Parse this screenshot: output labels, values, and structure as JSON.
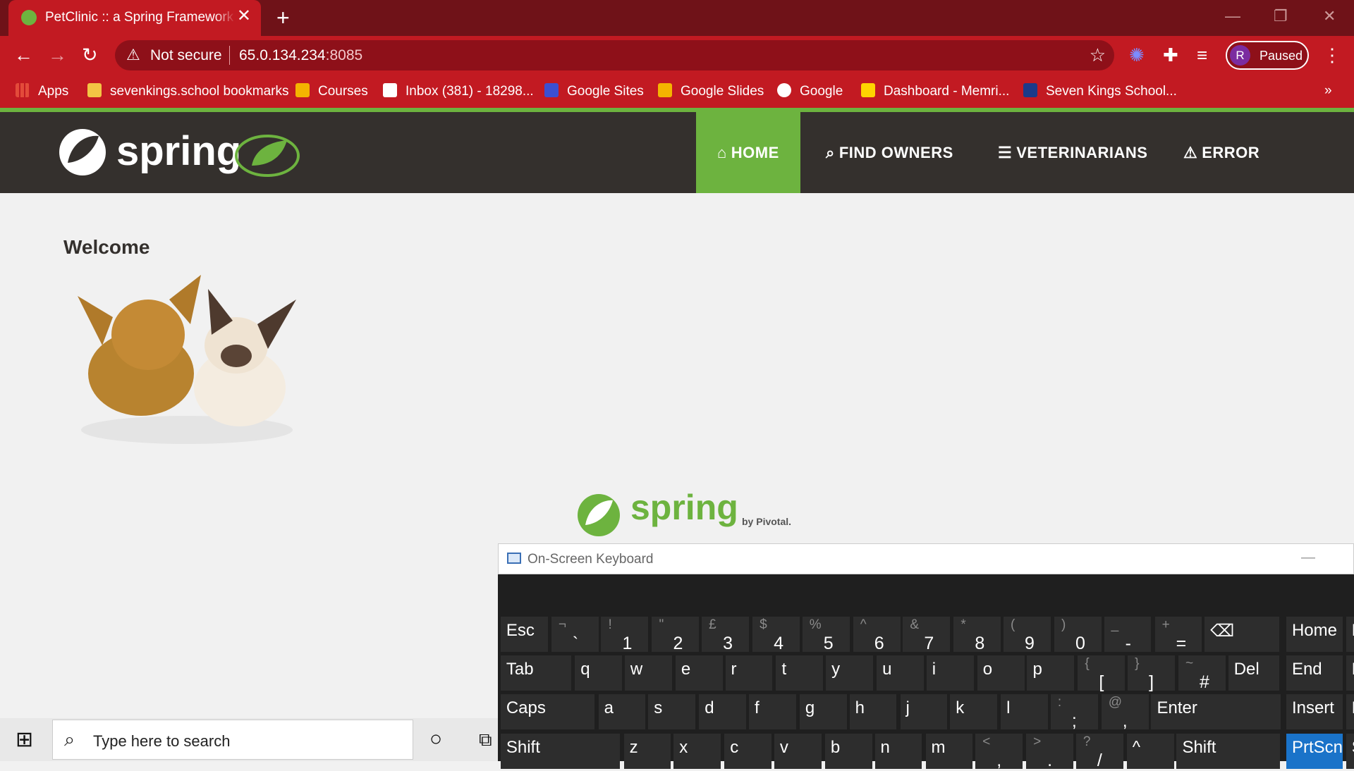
{
  "browser": {
    "tab_title": "PetClinic :: a Spring Framework demonstration",
    "tab_close": "✕",
    "new_tab": "+",
    "security_label": "Not secure",
    "url_host": "65.0.134.234",
    "url_port": ":8085",
    "profile_initial": "R",
    "profile_status": "Paused",
    "bookmarks": [
      {
        "label": "Apps",
        "icon": "apps-icon",
        "color": "#e34b3a"
      },
      {
        "label": "sevenkings.school bookmarks",
        "icon": "folder-icon",
        "color": "#f3c544"
      },
      {
        "label": "Courses",
        "icon": "classroom-icon",
        "color": "#f4b400"
      },
      {
        "label": "Inbox (381) - 18298...",
        "icon": "gmail-icon",
        "color": "#ffffff"
      },
      {
        "label": "Google Sites",
        "icon": "sites-icon",
        "color": "#3b4fd1"
      },
      {
        "label": "Google Slides",
        "icon": "slides-icon",
        "color": "#f4b400"
      },
      {
        "label": "Google",
        "icon": "google-icon",
        "color": "#ffffff"
      },
      {
        "label": "Dashboard - Memri...",
        "icon": "memrise-icon",
        "color": "#ffd400"
      },
      {
        "label": "Seven Kings School...",
        "icon": "school-icon",
        "color": "#1b3a8a"
      }
    ],
    "more_bookmarks": "»"
  },
  "site": {
    "nav": [
      {
        "label": "HOME",
        "icon": "home-icon",
        "active": true
      },
      {
        "label": "FIND OWNERS",
        "icon": "search-icon",
        "active": false
      },
      {
        "label": "VETERINARIANS",
        "icon": "list-icon",
        "active": false
      },
      {
        "label": "ERROR",
        "icon": "warning-icon",
        "active": false
      }
    ],
    "heading": "Welcome",
    "logo_text": "spring",
    "footer_logo_text": "spring",
    "footer_by": "by Pivotal."
  },
  "osk": {
    "title": "On-Screen Keyboard",
    "minimize": "—",
    "rows": [
      [
        [
          "Esc",
          ""
        ],
        [
          "`",
          "¬"
        ],
        [
          "1",
          "!"
        ],
        [
          "2",
          "\""
        ],
        [
          "3",
          "£"
        ],
        [
          "4",
          "$"
        ],
        [
          "5",
          "%"
        ],
        [
          "6",
          "^"
        ],
        [
          "7",
          "&"
        ],
        [
          "8",
          "*"
        ],
        [
          "9",
          "("
        ],
        [
          "0",
          ")"
        ],
        [
          "-",
          "_"
        ],
        [
          "=",
          "+"
        ],
        [
          "⌫",
          ""
        ],
        [
          "Home",
          ""
        ],
        [
          "PgUp",
          ""
        ]
      ],
      [
        [
          "Tab",
          ""
        ],
        [
          "q",
          ""
        ],
        [
          "w",
          ""
        ],
        [
          "e",
          ""
        ],
        [
          "r",
          ""
        ],
        [
          "t",
          ""
        ],
        [
          "y",
          ""
        ],
        [
          "u",
          ""
        ],
        [
          "i",
          ""
        ],
        [
          "o",
          ""
        ],
        [
          "p",
          ""
        ],
        [
          "[",
          "{"
        ],
        [
          "]",
          "}"
        ],
        [
          "#",
          "~"
        ],
        [
          "Del",
          ""
        ],
        [
          "End",
          ""
        ],
        [
          "PgDn",
          ""
        ]
      ],
      [
        [
          "Caps",
          ""
        ],
        [
          "a",
          ""
        ],
        [
          "s",
          ""
        ],
        [
          "d",
          ""
        ],
        [
          "f",
          ""
        ],
        [
          "g",
          ""
        ],
        [
          "h",
          ""
        ],
        [
          "j",
          ""
        ],
        [
          "k",
          ""
        ],
        [
          "l",
          ""
        ],
        [
          ";",
          ":"
        ],
        [
          ",",
          "@"
        ],
        [
          "Enter",
          ""
        ],
        [
          "Insert",
          ""
        ],
        [
          "Pause",
          ""
        ]
      ],
      [
        [
          "Shift",
          ""
        ],
        [
          "z",
          ""
        ],
        [
          "x",
          ""
        ],
        [
          "c",
          ""
        ],
        [
          "v",
          ""
        ],
        [
          "b",
          ""
        ],
        [
          "n",
          ""
        ],
        [
          "m",
          ""
        ],
        [
          ",",
          "<"
        ],
        [
          ".",
          ">"
        ],
        [
          "/",
          "?"
        ],
        [
          "^",
          ""
        ],
        [
          "Shift",
          ""
        ],
        [
          "PrtScn",
          ""
        ],
        [
          "ScrLk",
          ""
        ]
      ]
    ]
  },
  "taskbar": {
    "search_placeholder": "Type here to search"
  }
}
